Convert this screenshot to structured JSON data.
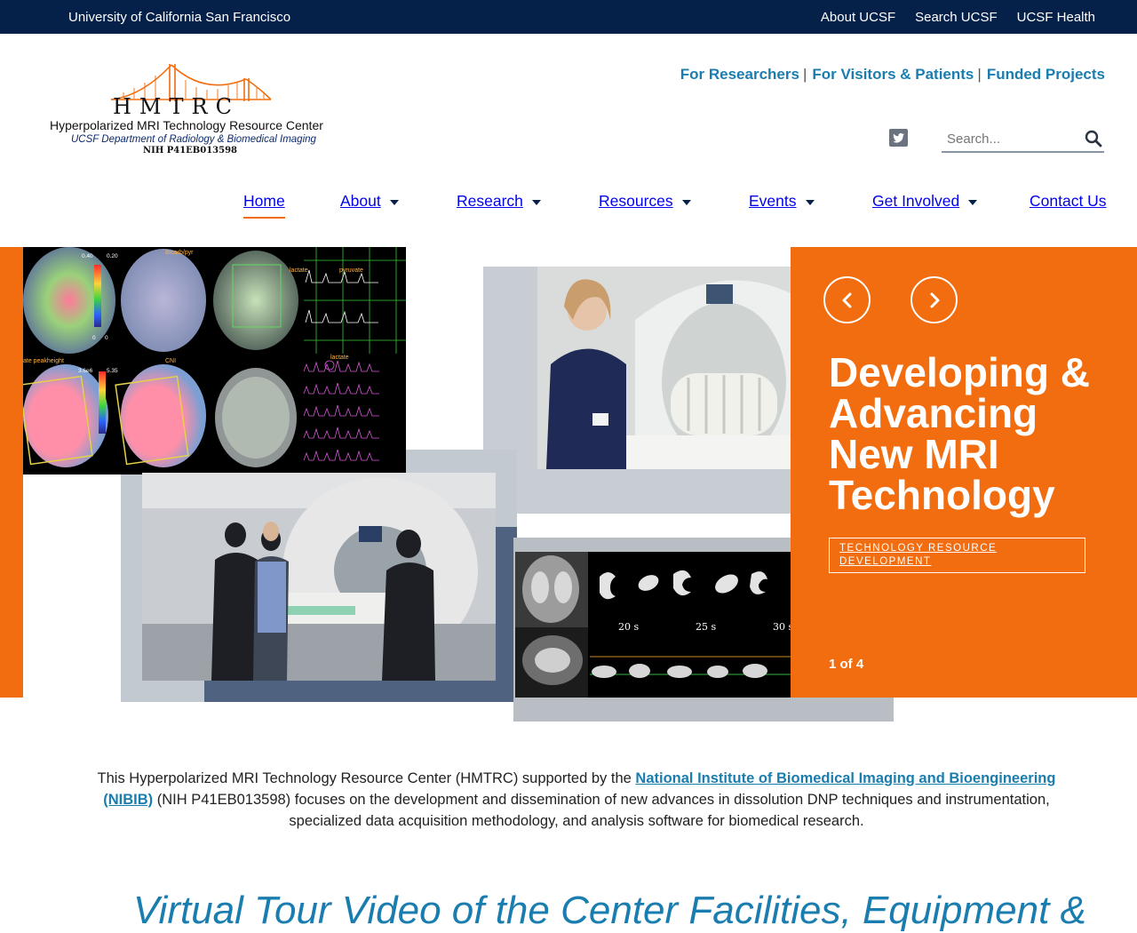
{
  "topbar": {
    "university": "University of California San Francisco",
    "links": [
      "About UCSF",
      "Search UCSF",
      "UCSF Health"
    ]
  },
  "logo": {
    "letters": "HMTRC",
    "full_name": "Hyperpolarized MRI Technology Resource Center",
    "department": "UCSF Department of Radiology & Biomedical Imaging",
    "grant": "NIH P41EB013598"
  },
  "utility_nav": {
    "items": [
      "For Researchers",
      "For Visitors & Patients",
      "Funded Projects"
    ],
    "separator": "|"
  },
  "search": {
    "placeholder": "Search..."
  },
  "main_nav": {
    "items": [
      {
        "label": "Home"
      },
      {
        "label": "About"
      },
      {
        "label": "Research"
      },
      {
        "label": "Resources"
      },
      {
        "label": "Events"
      },
      {
        "label": "Get Involved"
      },
      {
        "label": "Contact Us"
      }
    ]
  },
  "hero": {
    "headline": "Developing & Advancing New MRI Technology",
    "tag": "TECHNOLOGY RESOURCE DEVELOPMENT",
    "counter": "1 of 4",
    "scan_labels": [
      "20 s",
      "25 s",
      "30 s"
    ],
    "chart_labels": [
      "Bicarb/pyr",
      "lactate",
      "pyruvate",
      "lactate",
      "ate peakheight",
      "CNI"
    ],
    "scale_labels": [
      "0.40",
      "0.20",
      "0",
      "0",
      "3.6e6",
      "5.35"
    ]
  },
  "intro": {
    "text_before": "This Hyperpolarized MRI Technology Resource Center (HMTRC) supported by the ",
    "link_text": "National Institute of Biomedical Imaging and Bioengineering (NIBIB)",
    "text_after": " (NIH P41EB013598) focuses on the development and dissemination of new advances in dissolution DNP techniques and instrumentation, specialized data acquisition methodology, and analysis software for biomedical research."
  },
  "section_heading": "Virtual Tour Video of the Center Facilities, Equipment &",
  "colors": {
    "navy": "#052049",
    "orange": "#f26d0f",
    "link_blue": "#1a7db0",
    "slate": "#4f6280"
  }
}
